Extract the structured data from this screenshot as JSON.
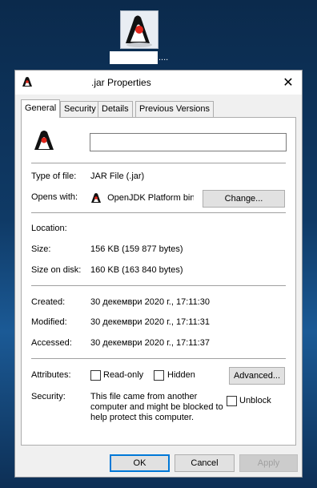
{
  "desktop": {
    "icon_name": "java-jar-icon",
    "label_suffix": "...."
  },
  "window": {
    "title": ".jar Properties",
    "close_glyph": "✕"
  },
  "tabs": [
    {
      "label": "General",
      "active": true
    },
    {
      "label": "Security",
      "active": false
    },
    {
      "label": "Details",
      "active": false
    },
    {
      "label": "Previous Versions",
      "active": false
    }
  ],
  "general": {
    "file_name_value": "",
    "type_label": "Type of file:",
    "type_value": "JAR File (.jar)",
    "opens_label": "Opens with:",
    "opens_value": "OpenJDK Platform binary",
    "change_label": "Change...",
    "location_label": "Location:",
    "location_value": "",
    "size_label": "Size:",
    "size_value": "156 KB (159 877 bytes)",
    "size_on_disk_label": "Size on disk:",
    "size_on_disk_value": "160 KB (163 840 bytes)",
    "created_label": "Created:",
    "created_value": "30 декември 2020 г., 17:11:30",
    "modified_label": "Modified:",
    "modified_value": "30 декември 2020 г., 17:11:31",
    "accessed_label": "Accessed:",
    "accessed_value": "30 декември 2020 г., 17:11:37",
    "attributes_label": "Attributes:",
    "readonly_label": "Read-only",
    "readonly_checked": false,
    "hidden_label": "Hidden",
    "hidden_checked": false,
    "advanced_label": "Advanced...",
    "security_label": "Security:",
    "security_text": "This file came from another computer and might be blocked to help protect this computer.",
    "unblock_label": "Unblock",
    "unblock_checked": false
  },
  "footer": {
    "ok_label": "OK",
    "cancel_label": "Cancel",
    "apply_label": "Apply"
  },
  "colors": {
    "accent": "#0078d7",
    "panel": "#ffffff",
    "dialog_bg": "#f0f0f0"
  }
}
